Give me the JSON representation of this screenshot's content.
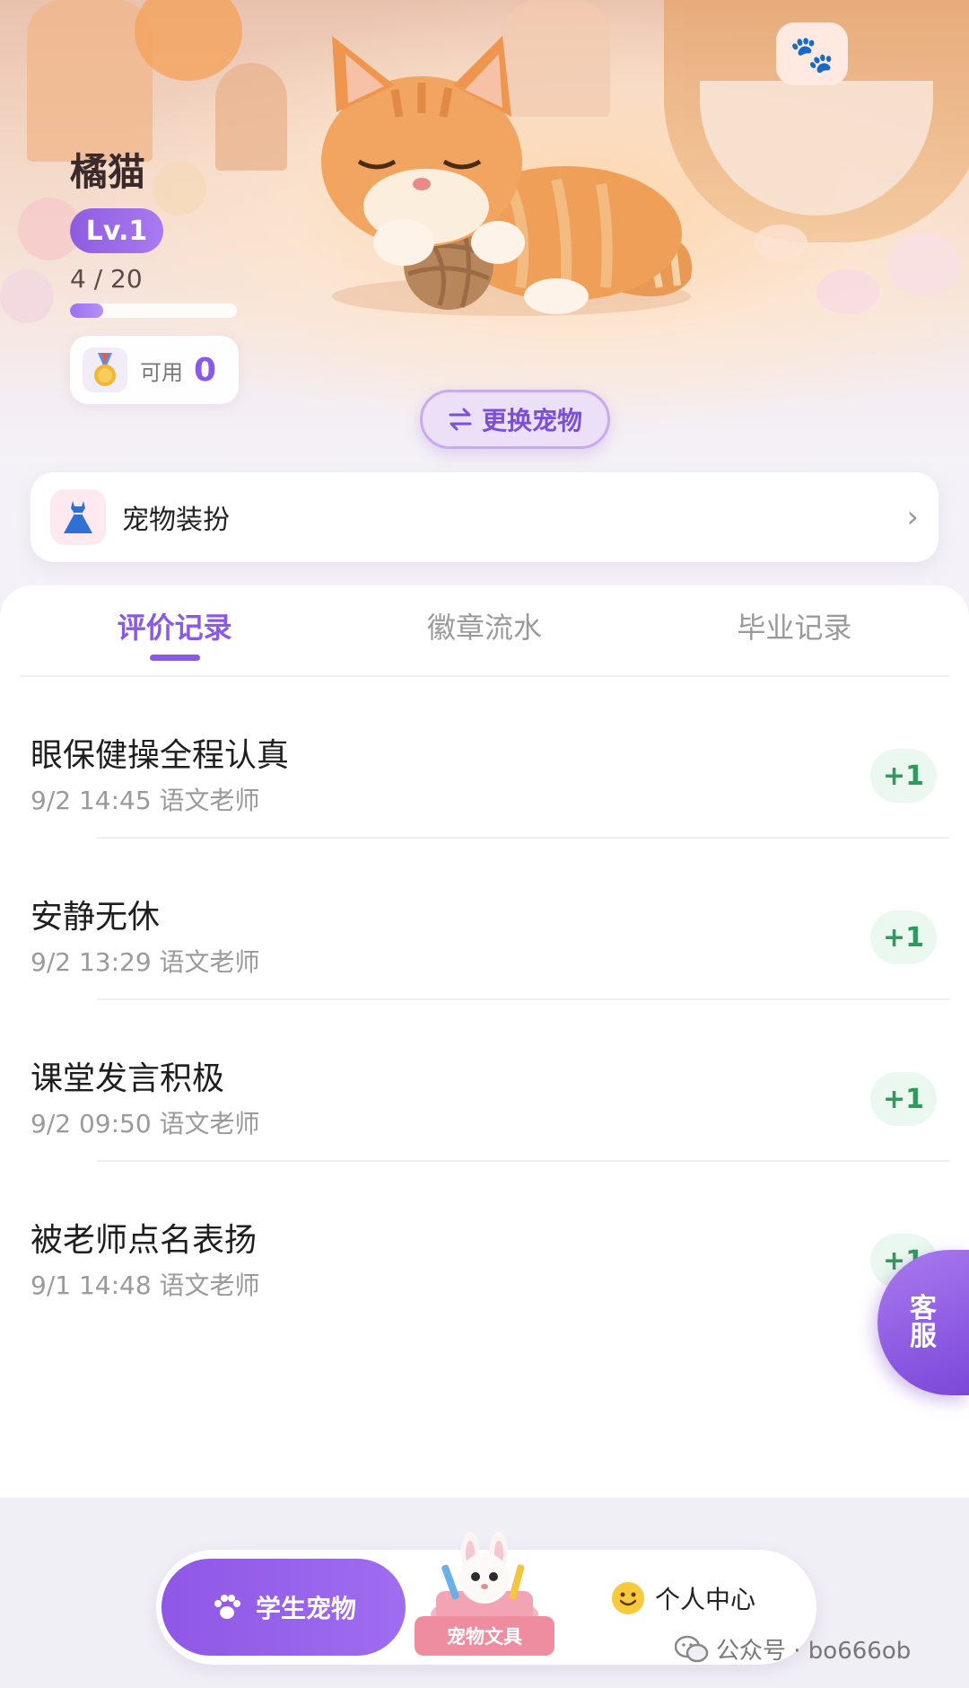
{
  "pet": {
    "name": "橘猫",
    "level": "Lv.1",
    "exp_text": "4 / 20",
    "exp_progress": 0.2,
    "coin_label": "可用",
    "coin_value": "0",
    "swap_label": "更换宠物"
  },
  "dress": {
    "label": "宠物装扮"
  },
  "tabs": [
    {
      "label": "评价记录",
      "active": true
    },
    {
      "label": "徽章流水",
      "active": false
    },
    {
      "label": "毕业记录",
      "active": false
    }
  ],
  "records": [
    {
      "title": "眼保健操全程认真",
      "meta": "9/2 14:45 语文老师",
      "score": "+1"
    },
    {
      "title": "安静无休",
      "meta": "9/2 13:29 语文老师",
      "score": "+1"
    },
    {
      "title": "课堂发言积极",
      "meta": "9/2 09:50 语文老师",
      "score": "+1"
    },
    {
      "title": "被老师点名表扬",
      "meta": "9/1 14:48 语文老师",
      "score": "+1"
    }
  ],
  "customer_service": {
    "line1": "客",
    "line2": "服"
  },
  "bottom_nav": {
    "pet_label": "学生宠物",
    "shop_label": "宠物文具",
    "me_label": "个人中心"
  },
  "watermark": "公众号 · bo666ob",
  "colors": {
    "accent": "#8a59e6",
    "score_green": "#2f9a5d"
  },
  "icons": [
    "medal-icon",
    "swap-icon",
    "dress-icon",
    "chevron-right-icon",
    "paw-icon",
    "smile-icon",
    "wechat-icon"
  ]
}
